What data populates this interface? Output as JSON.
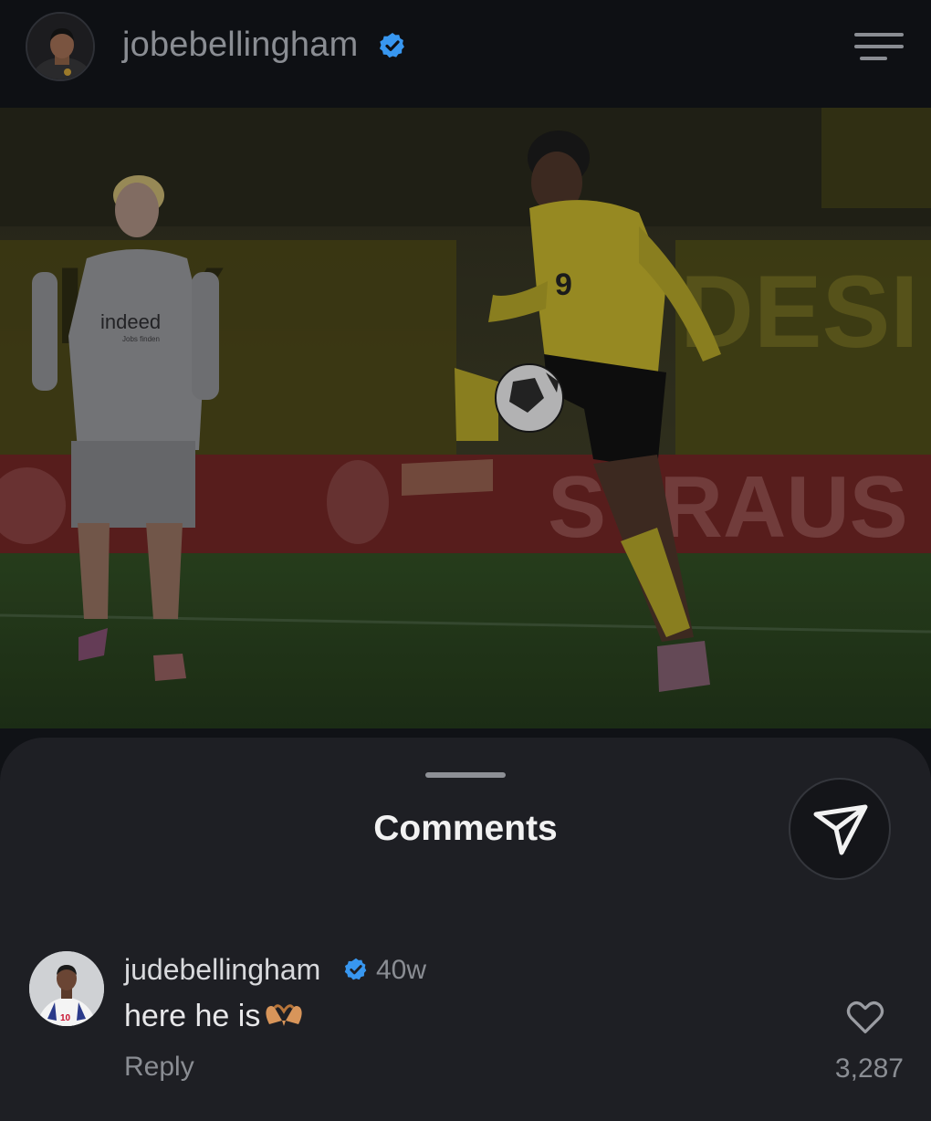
{
  "header": {
    "username": "jobebellingham",
    "verified": true,
    "menu_icon": "menu-icon"
  },
  "post": {
    "image_description": "photo",
    "sponsor_text": "indeed",
    "sponsor_sub": "Jobs finden",
    "jersey_number": "9",
    "boards_left": "ITY",
    "boards_right": "DESI",
    "ad_text": "STRAUS"
  },
  "comments_sheet": {
    "title": "Comments",
    "share_icon": "send-icon",
    "comments": [
      {
        "username": "judebellingham",
        "verified": true,
        "time": "40w",
        "text": "here he is",
        "emoji": "heart-hands",
        "reply_label": "Reply",
        "like_count": "3,287"
      }
    ]
  },
  "colors": {
    "background": "#101216",
    "sheet": "#1e1f24",
    "muted_text": "#8a8d93",
    "verified_blue": "#3897f0",
    "dortmund_yellow": "#e8d21a"
  }
}
